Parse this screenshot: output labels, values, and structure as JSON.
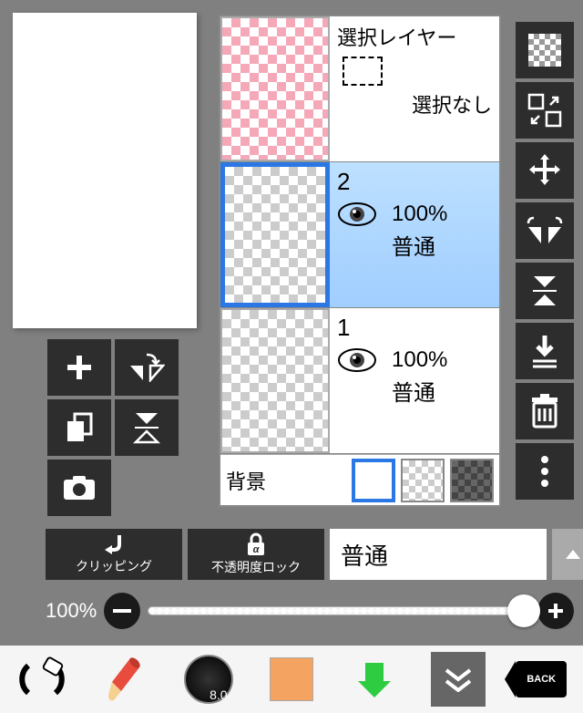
{
  "selection_layer": {
    "title": "選択レイヤー",
    "status": "選択なし"
  },
  "layers": [
    {
      "name": "2",
      "opacity": "100%",
      "blend": "普通",
      "selected": true
    },
    {
      "name": "1",
      "opacity": "100%",
      "blend": "普通",
      "selected": false
    }
  ],
  "background": {
    "label": "背景"
  },
  "clip_button": "クリッピング",
  "alpha_lock_button": "不透明度ロック",
  "blend_dropdown": "普通",
  "opacity_value": "100%",
  "brush_size": "8.0",
  "back_label": "BACK"
}
